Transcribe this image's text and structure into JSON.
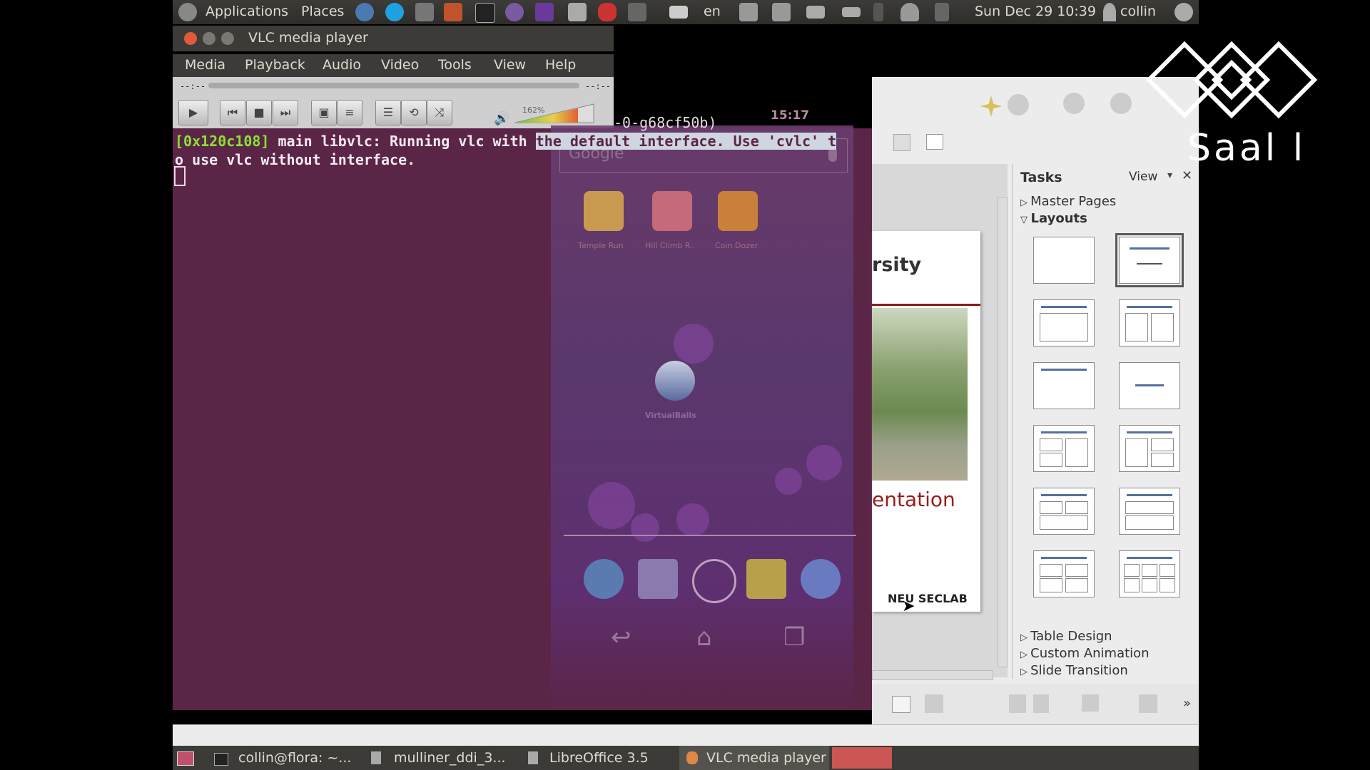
{
  "top_panel": {
    "applications": "Applications",
    "places": "Places",
    "keyboard_layout": "en",
    "datetime": "Sun Dec 29 10:39",
    "user": "collin"
  },
  "vlc": {
    "window_title": "VLC media player",
    "menu": [
      "Media",
      "Playback",
      "Audio",
      "Video",
      "Tools",
      "View",
      "Help"
    ],
    "time_elapsed": "--:--",
    "time_total": "--:--",
    "volume_pct": "162%"
  },
  "terminal": {
    "header_fragment": "-0-g68cf50b)",
    "address": "[0x120c108]",
    "line1_a": " main libvlc: Running vlc with ",
    "line1_hl": "the default interface. Use 'cvlc' t",
    "line2": "o use vlc without interface."
  },
  "android": {
    "clock": "15:17",
    "search_placeholder": "Google",
    "apps": [
      "Temple Run",
      "Hill Climb R..",
      "Coin Dozer"
    ],
    "folder_label": "VirtualBalls"
  },
  "libreoffice": {
    "slide_title_fragment": "rsity",
    "slide_subtitle_fragment": "entation",
    "slide_footer": "NEU SECLAB",
    "tasks_title": "Tasks",
    "tasks_view": "View",
    "sections": {
      "master_pages": "Master Pages",
      "layouts": "Layouts",
      "table_design": "Table Design",
      "custom_animation": "Custom Animation",
      "slide_transition": "Slide Transition"
    }
  },
  "taskbar": {
    "items": [
      "collin@flora: ~...",
      "mulliner_ddi_3...",
      "LibreOffice 3.5",
      "VLC media player"
    ]
  },
  "watermark": {
    "text": "Saal l"
  },
  "colors": {
    "terminal_bg": "#5b2547",
    "panel_bg": "#3c3b37",
    "accent_red": "#9b1b1b"
  }
}
